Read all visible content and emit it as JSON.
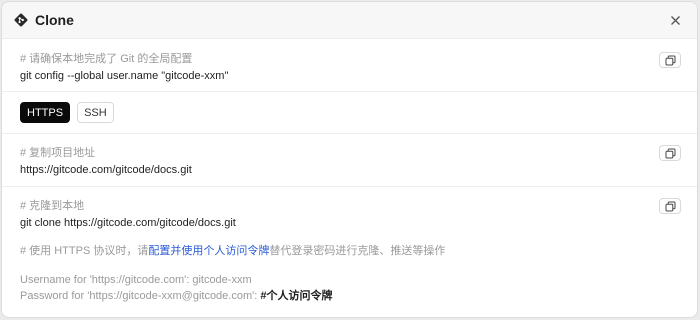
{
  "dialog": {
    "title": "Clone",
    "icons": {
      "title": "git-icon",
      "close": "close-icon",
      "copy": "copy-icon"
    }
  },
  "global_config": {
    "comment": "# 请确保本地完成了 Git 的全局配置",
    "command": "git config --global user.name \"gitcode-xxm\""
  },
  "protocols": {
    "options": [
      "HTTPS",
      "SSH"
    ],
    "selected": "HTTPS"
  },
  "copy_address": {
    "comment": "# 复制项目地址",
    "url": "https://gitcode.com/gitcode/docs.git"
  },
  "clone_local": {
    "comment": "# 克隆到本地",
    "command": "git clone https://gitcode.com/gitcode/docs.git",
    "note_prefix": "# 使用 HTTPS 协议时，请",
    "note_link": "配置并使用个人访问令牌",
    "note_suffix": "替代登录密码进行克隆、推送等操作",
    "username_line": "Username for 'https://gitcode.com': gitcode-xxm",
    "password_prefix": "Password for 'https://gitcode-xxm@gitcode.com': ",
    "password_value": "#个人访问令牌"
  },
  "colors": {
    "accent_link": "#2b5bd7",
    "active_tab": "#0a0a0a"
  }
}
